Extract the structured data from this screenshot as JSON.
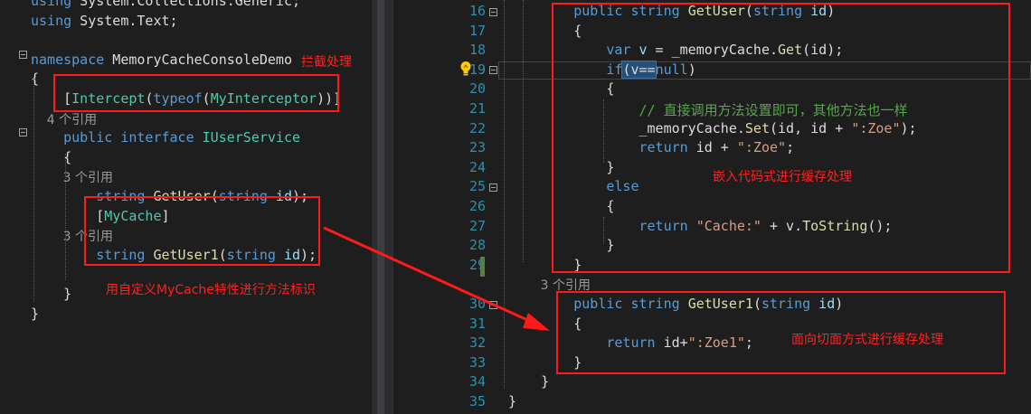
{
  "left": {
    "lines": [
      {
        "id": "l0",
        "parts": [
          [
            "kw",
            "using"
          ],
          [
            "tx",
            " System.Collections.Generic;"
          ]
        ]
      },
      {
        "id": "l1",
        "parts": [
          [
            "kw",
            "using"
          ],
          [
            "tx",
            " System.Text;"
          ]
        ]
      },
      {
        "id": "l2",
        "parts": []
      },
      {
        "id": "l3",
        "parts": [
          [
            "kw",
            "namespace"
          ],
          [
            "tx",
            " MemoryCacheConsoleDemo"
          ]
        ]
      },
      {
        "id": "l4",
        "parts": [
          [
            "tx",
            "{"
          ]
        ]
      },
      {
        "id": "l5",
        "parts": [
          [
            "tx",
            "    ["
          ],
          [
            "ty",
            "Intercept"
          ],
          [
            "tx",
            "("
          ],
          [
            "kw",
            "typeof"
          ],
          [
            "tx",
            "("
          ],
          [
            "ty",
            "MyInterceptor"
          ],
          [
            "tx",
            "))]"
          ]
        ]
      },
      {
        "id": "l6",
        "parts": [
          [
            "ref",
            "    4 个引用"
          ]
        ]
      },
      {
        "id": "l7",
        "parts": [
          [
            "kw",
            "    public interface "
          ],
          [
            "ty",
            "IUserService"
          ]
        ]
      },
      {
        "id": "l8",
        "parts": [
          [
            "tx",
            "    {"
          ]
        ]
      },
      {
        "id": "l9",
        "parts": [
          [
            "ref",
            "        3 个引用"
          ]
        ]
      },
      {
        "id": "l10",
        "parts": [
          [
            "kw",
            "        string "
          ],
          [
            "fn",
            "GetUser"
          ],
          [
            "tx",
            "("
          ],
          [
            "kw",
            "string"
          ],
          [
            "id",
            " id"
          ],
          [
            "tx",
            ");"
          ]
        ]
      },
      {
        "id": "l11",
        "parts": [
          [
            "tx",
            "        ["
          ],
          [
            "ty",
            "MyCache"
          ],
          [
            "tx",
            "]"
          ]
        ]
      },
      {
        "id": "l12",
        "parts": [
          [
            "ref",
            "        3 个引用"
          ]
        ]
      },
      {
        "id": "l13",
        "parts": [
          [
            "kw",
            "        string "
          ],
          [
            "fn",
            "GetUser1"
          ],
          [
            "tx",
            "("
          ],
          [
            "kw",
            "string"
          ],
          [
            "id",
            " id"
          ],
          [
            "tx",
            ");"
          ]
        ]
      },
      {
        "id": "l14",
        "parts": []
      },
      {
        "id": "l15",
        "parts": [
          [
            "tx",
            "    }"
          ]
        ]
      },
      {
        "id": "l16",
        "parts": [
          [
            "tx",
            "}"
          ]
        ]
      }
    ]
  },
  "right": {
    "line_numbers": [
      "16",
      "17",
      "18",
      "19",
      "20",
      "21",
      "22",
      "23",
      "24",
      "25",
      "26",
      "27",
      "28",
      "29",
      "",
      "30",
      "31",
      "32",
      "33",
      "34",
      "35"
    ],
    "lines": [
      {
        "id": "r16",
        "parts": [
          [
            "kw",
            "        public string "
          ],
          [
            "fn",
            "GetUser"
          ],
          [
            "tx",
            "("
          ],
          [
            "kw",
            "string"
          ],
          [
            "id",
            " id"
          ],
          [
            "tx",
            ")"
          ]
        ]
      },
      {
        "id": "r17",
        "parts": [
          [
            "tx",
            "        {"
          ]
        ]
      },
      {
        "id": "r18",
        "parts": [
          [
            "kw",
            "            var"
          ],
          [
            "id",
            " v"
          ],
          [
            "tx",
            " = _memoryCache."
          ],
          [
            "fn",
            "Get"
          ],
          [
            "tx",
            "(id);"
          ]
        ]
      },
      {
        "id": "r19",
        "parts": [
          [
            "kw",
            "            if"
          ],
          [
            "tx",
            "(v=="
          ],
          [
            "kw",
            "null"
          ],
          [
            "tx",
            ")"
          ]
        ]
      },
      {
        "id": "r20",
        "parts": [
          [
            "tx",
            "            {"
          ]
        ]
      },
      {
        "id": "r21",
        "parts": [
          [
            "cm",
            "                // 直接调用方法设置即可，其他方法也一样"
          ]
        ]
      },
      {
        "id": "r22",
        "parts": [
          [
            "tx",
            "                _memoryCache."
          ],
          [
            "fn",
            "Set"
          ],
          [
            "tx",
            "(id, id + "
          ],
          [
            "str",
            "\":Zoe\""
          ],
          [
            "tx",
            ");"
          ]
        ]
      },
      {
        "id": "r23",
        "parts": [
          [
            "kw",
            "                return"
          ],
          [
            "tx",
            " id + "
          ],
          [
            "str",
            "\":Zoe\""
          ],
          [
            "tx",
            ";"
          ]
        ]
      },
      {
        "id": "r24",
        "parts": [
          [
            "tx",
            "            }"
          ]
        ]
      },
      {
        "id": "r25",
        "parts": [
          [
            "kw",
            "            else"
          ]
        ]
      },
      {
        "id": "r26",
        "parts": [
          [
            "tx",
            "            {"
          ]
        ]
      },
      {
        "id": "r27",
        "parts": [
          [
            "kw",
            "                return "
          ],
          [
            "str",
            "\"Cache:\""
          ],
          [
            "tx",
            " + v."
          ],
          [
            "fn",
            "ToString"
          ],
          [
            "tx",
            "();"
          ]
        ]
      },
      {
        "id": "r28",
        "parts": [
          [
            "tx",
            "            }"
          ]
        ]
      },
      {
        "id": "r29",
        "parts": [
          [
            "tx",
            "        }"
          ]
        ]
      },
      {
        "id": "rref",
        "parts": [
          [
            "ref",
            "        3 个引用"
          ]
        ]
      },
      {
        "id": "r30",
        "parts": [
          [
            "kw",
            "        public string "
          ],
          [
            "fn",
            "GetUser1"
          ],
          [
            "tx",
            "("
          ],
          [
            "kw",
            "string"
          ],
          [
            "id",
            " id"
          ],
          [
            "tx",
            ")"
          ]
        ]
      },
      {
        "id": "r31",
        "parts": [
          [
            "tx",
            "        {"
          ]
        ]
      },
      {
        "id": "r32",
        "parts": [
          [
            "kw",
            "            return"
          ],
          [
            "tx",
            " id+"
          ],
          [
            "str",
            "\":Zoe1\""
          ],
          [
            "tx",
            ";"
          ]
        ]
      },
      {
        "id": "r33",
        "parts": [
          [
            "tx",
            "        }"
          ]
        ]
      },
      {
        "id": "r34",
        "parts": [
          [
            "tx",
            "    }"
          ]
        ]
      },
      {
        "id": "r35",
        "parts": [
          [
            "tx",
            "}"
          ]
        ]
      }
    ]
  },
  "annotations": {
    "intercept": "拦截处理",
    "mycache": "用自定义MyCache特性进行方法标识",
    "embedded": "嵌入代码式进行缓存处理",
    "aspect": "面向切面方式进行缓存处理"
  },
  "icons": {
    "lightbulb": "lightbulb-icon"
  },
  "colors": {
    "annotation": "#ff1a1a",
    "background": "#1e1e1e",
    "line_number": "#2b91af"
  }
}
